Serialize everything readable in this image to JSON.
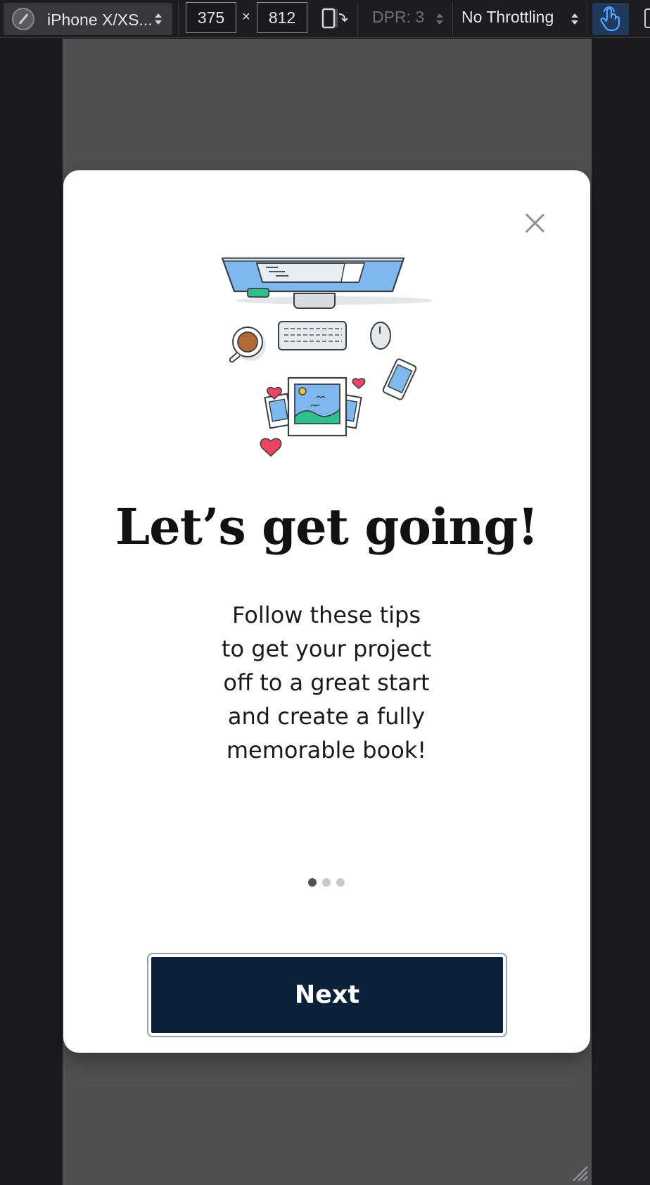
{
  "devtools": {
    "device_name": "iPhone X/XS...",
    "width": "375",
    "times": "×",
    "height": "812",
    "dpr": "DPR: 3",
    "throttling": "No Throttling"
  },
  "modal": {
    "title": "Let’s get going!",
    "body": "Follow these tips to get your project off to a great start and create a fully memorable book!",
    "pagination": {
      "total": 3,
      "active": 1
    },
    "next_label": "Next"
  },
  "colors": {
    "button_bg": "#0a2139",
    "viewport_bg": "#505050",
    "dot_active": "#4d545b",
    "dot_inactive": "#c6cbd0"
  }
}
